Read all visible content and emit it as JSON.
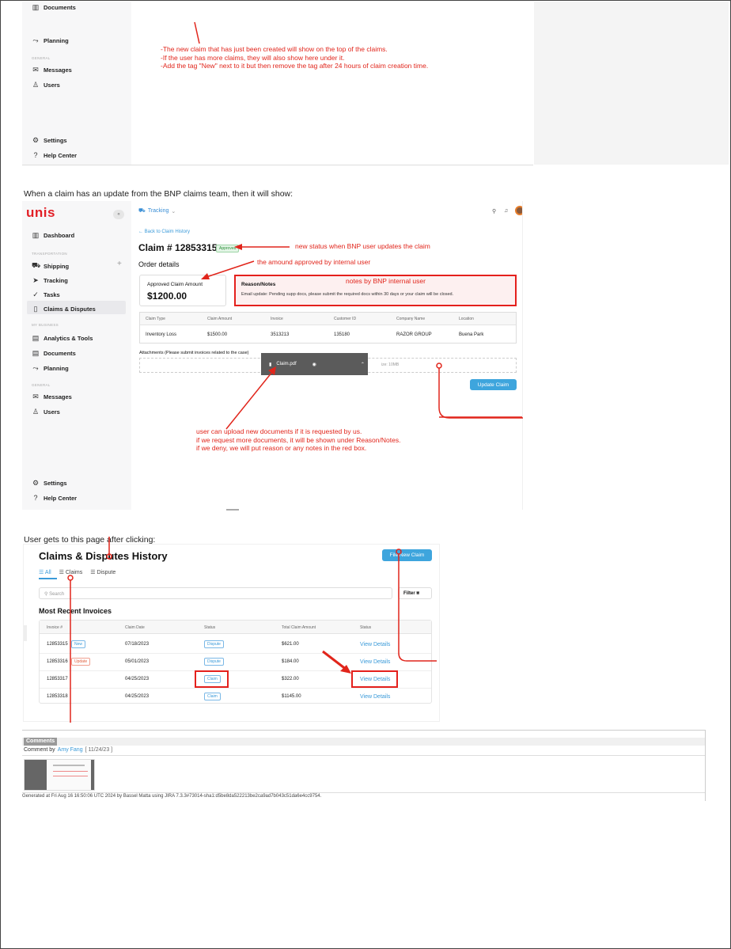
{
  "top": {
    "sidebar": [
      {
        "label": "Documents",
        "icon": "documents-icon"
      },
      {
        "label": "Planning",
        "icon": "planning-icon"
      },
      {
        "label": "Messages",
        "icon": "messages-icon"
      },
      {
        "label": "Users",
        "icon": "users-icon"
      },
      {
        "label": "Settings",
        "icon": "gear-icon"
      },
      {
        "label": "Help Center",
        "icon": "help-icon"
      }
    ],
    "section_general": "GENERAL",
    "notes": [
      "-The new claim that has just been created will show on the top of the claims.",
      "-If the user has more claims, they will also show here under it.",
      "-Add the tag \"New\" next to it but then remove the tag after 24 hours of claim creation time."
    ]
  },
  "caption1": "When a claim has an update from the BNP claims team, then it will show:",
  "app": {
    "logo": "unis",
    "header": {
      "module": "Tracking"
    },
    "sidebar": {
      "dashboard": "Dashboard",
      "section_transportation": "TRANSPORTATION",
      "shipping": "Shipping",
      "tracking": "Tracking",
      "tasks": "Tasks",
      "claims": "Claims & Disputes",
      "section_business": "MY BUSINESS",
      "analytics": "Analytics & Tools",
      "documents": "Documents",
      "planning": "Planning",
      "section_general": "GENERAL",
      "messages": "Messages",
      "users": "Users",
      "settings": "Settings",
      "help": "Help Center"
    },
    "back_link": "← Back to Claim History",
    "claim_title": "Claim # 12853315",
    "status_badge": "Approved",
    "order_details": "Order details",
    "approved_label": "Approved Claim Amount",
    "approved_value": "$1200.00",
    "reason_title": "Reason/Notes",
    "reason_text": "Email update: Pending supp docs, please submit the required docs within 30 days or your claim will be closed.",
    "table": {
      "headers": [
        "Claim Type",
        "Claim Amount",
        "Invoice",
        "Customer ID",
        "Company Name",
        "Location"
      ],
      "row": [
        "Inventory Loss",
        "$1500.00",
        "3513213",
        "135180",
        "RAZOR GROUP",
        "Buena Park"
      ]
    },
    "attachments_label": "Attachments (Please submit invoices related to the case)",
    "file_name": "Claim.pdf",
    "max_size": "ize: 10MB",
    "update_button": "Update Claim",
    "annotations": {
      "status": "new status when BNP user updates the claim",
      "amount": "the amound approved by internal user",
      "notes": "notes by BNP internal user",
      "upload": [
        "user can upload new documents if it is requested by us.",
        "if we request more documents, it will be shown under Reason/Notes.",
        "if we deny, we will put reason or any notes in the red box."
      ]
    }
  },
  "caption2": "User gets to this page after clicking:",
  "history": {
    "title": "Claims & Disputes History",
    "file_button": "File New Claim",
    "tabs": [
      "All",
      "Claims",
      "Dispute"
    ],
    "search_placeholder": "Search",
    "filter": "Filter",
    "section": "Most Recent Invoices",
    "headers": [
      "Invoice #",
      "Claim Date",
      "Status",
      "Total Claim Amount",
      "Status"
    ],
    "rows": [
      {
        "invoice": "12853315",
        "tag": "New",
        "date": "07/18/2023",
        "status": "Dispute",
        "amount": "$621.00",
        "action": "View Details"
      },
      {
        "invoice": "12853316",
        "tag": "Update",
        "date": "05/01/2023",
        "status": "Dispute",
        "amount": "$184.00",
        "action": "View Details"
      },
      {
        "invoice": "12853317",
        "tag": "",
        "date": "04/25/2023",
        "status": "Claim",
        "amount": "$322.00",
        "action": "View Details"
      },
      {
        "invoice": "12853318",
        "tag": "",
        "date": "04/25/2023",
        "status": "Claim",
        "amount": "$1145.00",
        "action": "View Details"
      }
    ]
  },
  "comments": {
    "header": "Comments",
    "by_prefix": "Comment by",
    "author": "Amy Fang",
    "date": "[ 11/24/23 ]"
  },
  "footer": "Generated at Fri Aug 16 16:50:06 UTC 2024 by Bassel Matta using JIRA 7.3.3#73014-sha1:d5be8da522213be2ca9ad7b043c51da6e4cc9754."
}
